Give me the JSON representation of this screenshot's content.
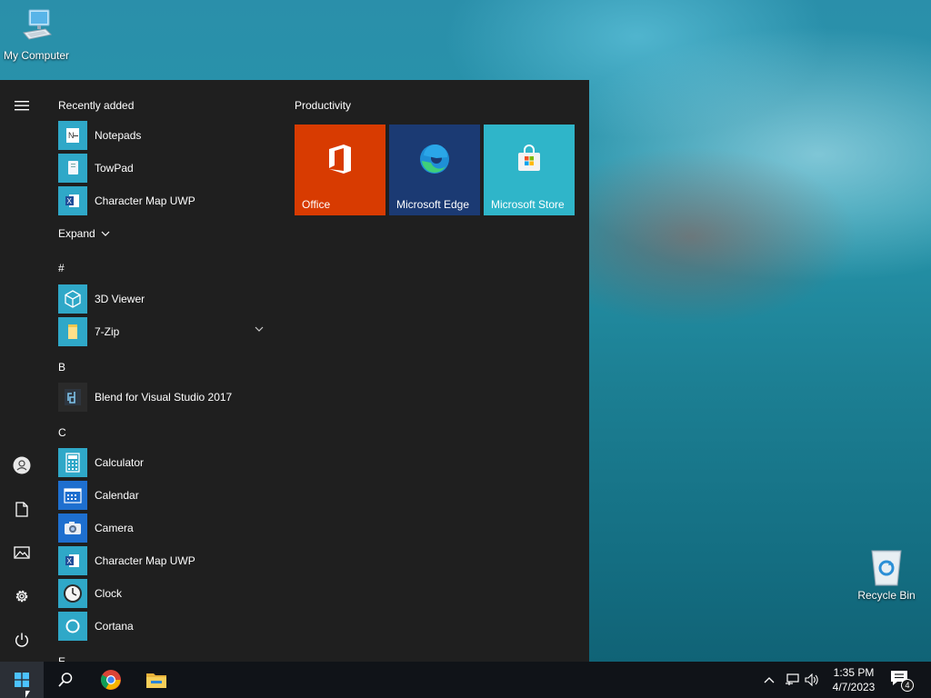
{
  "desktop": {
    "icons": [
      {
        "label": "My Computer",
        "icon": "computer-icon"
      },
      {
        "label": "Recycle Bin",
        "icon": "recycle-bin-icon"
      }
    ]
  },
  "start_menu": {
    "recently_added_header": "Recently added",
    "recent_apps": [
      {
        "name": "Notepads",
        "icon": "notepads-icon",
        "color": "#2fa8c8"
      },
      {
        "name": "TowPad",
        "icon": "towpad-icon",
        "color": "#2fa8c8"
      },
      {
        "name": "Character Map UWP",
        "icon": "character-map-icon",
        "color": "#2fa8c8"
      }
    ],
    "expand_label": "Expand",
    "groups": [
      {
        "letter": "#",
        "apps": [
          {
            "name": "3D Viewer",
            "icon": "3d-viewer-icon",
            "color": "#2fa8c8"
          },
          {
            "name": "7-Zip",
            "icon": "folder-icon",
            "color": "#2fa8c8",
            "expandable": true
          }
        ]
      },
      {
        "letter": "B",
        "apps": [
          {
            "name": "Blend for Visual Studio 2017",
            "icon": "blend-icon",
            "color": "#2a2a2a"
          }
        ]
      },
      {
        "letter": "C",
        "apps": [
          {
            "name": "Calculator",
            "icon": "calculator-icon",
            "color": "#2fa8c8"
          },
          {
            "name": "Calendar",
            "icon": "calendar-icon",
            "color": "#1e6fcf"
          },
          {
            "name": "Camera",
            "icon": "camera-icon",
            "color": "#1e6fcf"
          },
          {
            "name": "Character Map UWP",
            "icon": "character-map-icon",
            "color": "#2fa8c8"
          },
          {
            "name": "Clock",
            "icon": "clock-icon",
            "color": "#2fa8c8"
          },
          {
            "name": "Cortana",
            "icon": "cortana-icon",
            "color": "#2fa8c8"
          }
        ]
      },
      {
        "letter": "E",
        "apps": []
      }
    ],
    "tiles_group_title": "Productivity",
    "tiles": [
      {
        "label": "Office",
        "icon": "office-icon",
        "color": "#d83b01"
      },
      {
        "label": "Microsoft Edge",
        "icon": "edge-icon",
        "color": "#1b3a73"
      },
      {
        "label": "Microsoft Store",
        "icon": "store-icon",
        "color": "#2fb5c9"
      }
    ],
    "rail": [
      "hamburger-menu-icon",
      "user-icon",
      "documents-icon",
      "pictures-icon",
      "settings-icon",
      "power-icon"
    ]
  },
  "taskbar": {
    "time": "1:35 PM",
    "date": "4/7/2023",
    "notification_count": "4"
  }
}
